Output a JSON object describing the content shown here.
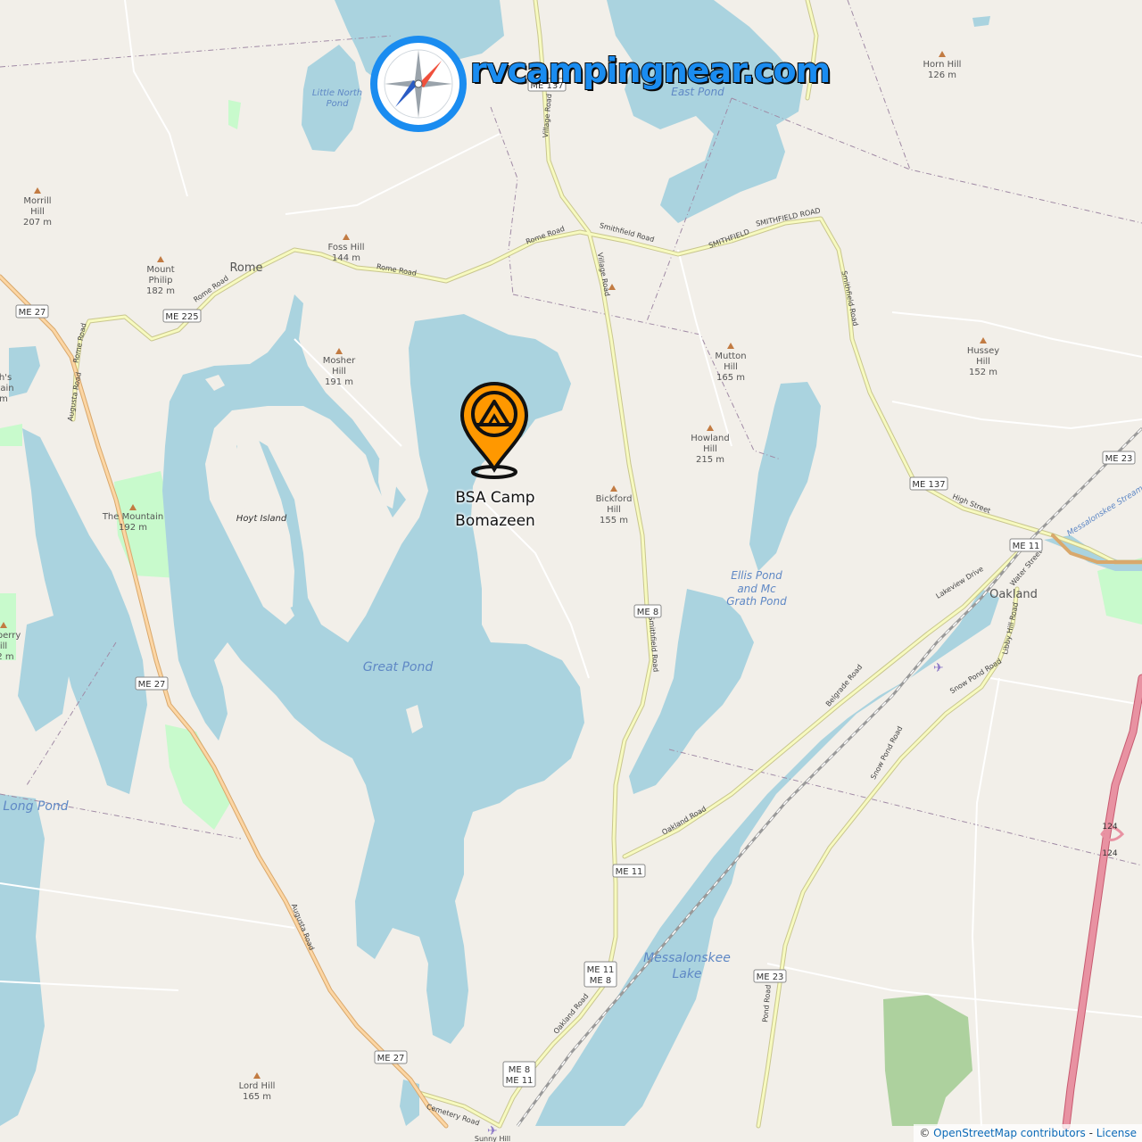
{
  "brand": {
    "name": "rvcampingnear.com"
  },
  "camp": {
    "line1": "BSA Camp",
    "line2": "Bomazeen"
  },
  "water_labels": {
    "little_north_pond_1": "Little North",
    "little_north_pond_2": "Pond",
    "east_pond": "East Pond",
    "great_pond": "Great Pond",
    "long_pond": "Long Pond",
    "ellis_1": "Ellis Pond",
    "ellis_2": "and Mc",
    "ellis_3": "Grath Pond",
    "messalonskee_1": "Messalonskee",
    "messalonskee_2": "Lake",
    "messalonskee_stream": "Messalonskee Stream",
    "hoyt_island": "Hoyt Island"
  },
  "places": {
    "rome": "Rome",
    "oakland": "Oakland"
  },
  "hills": {
    "morrill": [
      "Morrill",
      "Hill",
      "207 m"
    ],
    "mount_philip": [
      "Mount",
      "Philip",
      "182 m"
    ],
    "foss": [
      "Foss Hill",
      "144 m"
    ],
    "mosher": [
      "Mosher",
      "Hill",
      "191 m"
    ],
    "the_mountain": [
      "The Mountain",
      "192 m"
    ],
    "mutton": [
      "Mutton",
      "Hill",
      "165 m"
    ],
    "howland": [
      "Howland",
      "Hill",
      "215 m"
    ],
    "bickford": [
      "Bickford",
      "Hill",
      "155 m"
    ],
    "hussey": [
      "Hussey",
      "Hill",
      "152 m"
    ],
    "horn": [
      "Horn Hill",
      "126 m"
    ],
    "lord": [
      "Lord Hill",
      "165 m"
    ],
    "left_partial_1": [
      "h's",
      "tain",
      "m"
    ],
    "left_partial_2": [
      "berry",
      "ill",
      "2 m"
    ]
  },
  "shields": {
    "me27_a": "ME 27",
    "me225": "ME 225",
    "me27_b": "ME 27",
    "me27_c": "ME 27",
    "me8_a": "ME 8",
    "me11_a": "ME 11",
    "me11_me8_1": "ME 11",
    "me11_me8_2": "ME 8",
    "me8_me11_1": "ME 8",
    "me8_me11_2": "ME 11",
    "me23_a": "ME 23",
    "me23_b": "ME 23",
    "me137": "ME 137",
    "me11_b": "ME 11",
    "me137_top": "ME 137",
    "i95_a": "124",
    "i95_b": "124"
  },
  "roads": {
    "rome_road_1": "Rome Road",
    "rome_road_2": "Rome Road",
    "rome_road_3": "Rome Road",
    "rome_road_4": "Rome Road",
    "smithfield_1": "Smithfield Road",
    "smithfield_2": "SMITHFIELD",
    "smithfield_3": "SMITHFIELD ROAD",
    "smithfield_4": "Smithfield Road",
    "smithfield_5": "Smithfield Road",
    "village_1": "Village Road",
    "village_2": "Village Road",
    "augusta_1": "Augusta Road",
    "augusta_2": "Augusta Road",
    "high_street": "High Street",
    "lakeview": "Lakeview Drive",
    "water_street": "Water Street",
    "libby_hill": "Libby Hill Road",
    "belgrade": "Belgrade Road",
    "snow_pond_1": "Snow Pond Road",
    "snow_pond_2": "Snow Pond Road",
    "oakland_1": "Oakland Road",
    "oakland_2": "Oakland Road",
    "pond_road": "Pond Road",
    "cemetery": "Cemetery Road",
    "sunny_hill": "Sunny Hill"
  },
  "attribution": {
    "prefix": "© ",
    "osm": "OpenStreetMap contributors",
    "sep": " - ",
    "license": "License"
  },
  "colors": {
    "water": "#aad3df",
    "land": "#f2efe9",
    "road": "#f7fabf",
    "road_edge": "#c9c68f",
    "trunk": "#e892a2",
    "park": "#c8facc",
    "forest": "#add19e",
    "marker": "#ff8c00",
    "brand": "#1a8cf0"
  }
}
